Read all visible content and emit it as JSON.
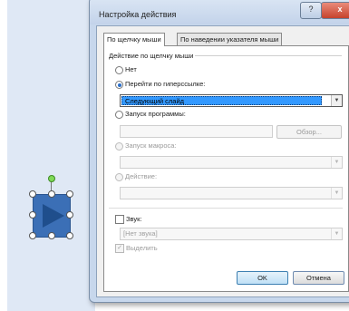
{
  "dialog": {
    "title": "Настройка действия",
    "help_button": "?",
    "close_button": "x"
  },
  "tabs": [
    {
      "label": "По щелчку мыши",
      "active": true
    },
    {
      "label": "По наведении указателя мыши",
      "active": false
    }
  ],
  "action_group": {
    "label": "Действие по щелчку мыши",
    "options": [
      {
        "label": "Нет",
        "checked": false,
        "enabled": true
      },
      {
        "label": "Перейти по гиперссылке:",
        "checked": true,
        "enabled": true
      },
      {
        "label": "Запуск программы:",
        "checked": false,
        "enabled": true
      },
      {
        "label": "Запуск макроса:",
        "checked": false,
        "enabled": false
      },
      {
        "label": "Действие:",
        "checked": false,
        "enabled": false
      }
    ],
    "hyperlink_value": "Следующий слайд",
    "browse_button": "Обзор..."
  },
  "sound": {
    "label": "Звук:",
    "checked": false,
    "value": "[Нет звука]"
  },
  "highlight": {
    "label": "Выделить",
    "checked": true
  },
  "buttons": {
    "ok": "OK",
    "cancel": "Отмена"
  },
  "colors": {
    "shape_fill": "#3b6fb6",
    "slide_background": "#dfe8f5",
    "selection": "#3399ff"
  }
}
